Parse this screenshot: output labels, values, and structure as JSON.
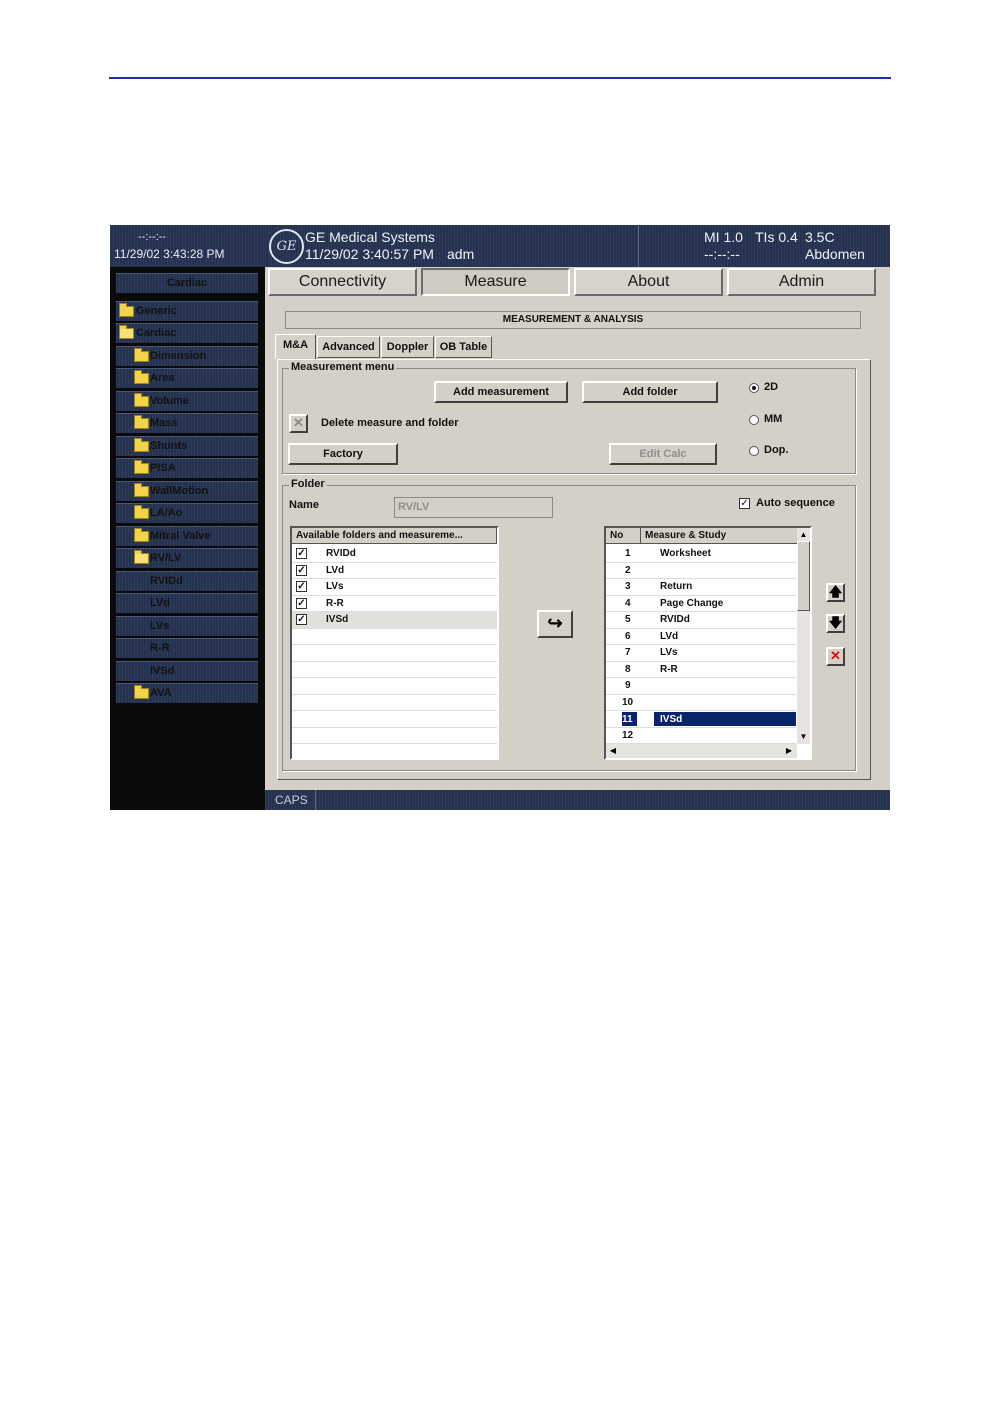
{
  "status_left": {
    "clock": "--:--:--",
    "datetime": "11/29/02 3:43:28 PM"
  },
  "header": {
    "logo": "GE",
    "system": "GE Medical Systems",
    "datetime": "11/29/02 3:40:57 PM",
    "user": "adm",
    "mi": "MI 1.0",
    "tis": "TIs 0.4",
    "probe": "3.5C",
    "dashes": "--:--:--",
    "application": "Abdomen"
  },
  "sidebar": {
    "title": "Cardiac",
    "items": [
      {
        "label": "Generic"
      },
      {
        "label": "Cardiac"
      },
      {
        "label": "Dimension"
      },
      {
        "label": "Area"
      },
      {
        "label": "Volume"
      },
      {
        "label": "Mass"
      },
      {
        "label": "Shunts"
      },
      {
        "label": "PISA"
      },
      {
        "label": "WallMotion"
      },
      {
        "label": "LA/Ao"
      },
      {
        "label": "Mitral Valve"
      },
      {
        "label": "RV/LV"
      },
      {
        "label": "RVIDd"
      },
      {
        "label": "LVd"
      },
      {
        "label": "LVs"
      },
      {
        "label": "R-R"
      },
      {
        "label": "IVSd"
      },
      {
        "label": "AVA"
      }
    ]
  },
  "tabs": [
    "Connectivity",
    "Measure",
    "About",
    "Admin"
  ],
  "page_title": "MEASUREMENT & ANALYSIS",
  "subtabs": [
    "M&A",
    "Advanced",
    "Doppler",
    "OB Table"
  ],
  "measurement_menu": {
    "legend": "Measurement menu",
    "add_measurement": "Add measurement",
    "add_folder": "Add folder",
    "delete_label": "Delete measure and folder",
    "factory": "Factory",
    "edit_calc": "Edit Calc",
    "modes": [
      "2D",
      "MM",
      "Dop."
    ],
    "selected_mode": "2D"
  },
  "folder": {
    "legend": "Folder",
    "name_label": "Name",
    "name_value": "RV/LV",
    "auto_sequence": "Auto sequence",
    "auto_checked": "✓"
  },
  "available_list": {
    "header": "Available folders and measureme...",
    "items": [
      {
        "label": "RVIDd",
        "check": "✓"
      },
      {
        "label": "LVd",
        "check": "✓"
      },
      {
        "label": "LVs",
        "check": "✓"
      },
      {
        "label": "R-R",
        "check": "✓"
      },
      {
        "label": "IVSd",
        "check": "✓"
      }
    ]
  },
  "transfer_glyph": "↪",
  "study_list": {
    "col_no": "No",
    "col_name": "Measure & Study",
    "rows": [
      {
        "no": "1",
        "name": "Worksheet"
      },
      {
        "no": "2",
        "name": ""
      },
      {
        "no": "3",
        "name": "Return"
      },
      {
        "no": "4",
        "name": "Page Change"
      },
      {
        "no": "5",
        "name": "RVIDd"
      },
      {
        "no": "6",
        "name": "LVd"
      },
      {
        "no": "7",
        "name": "LVs"
      },
      {
        "no": "8",
        "name": "R-R"
      },
      {
        "no": "9",
        "name": ""
      },
      {
        "no": "10",
        "name": ""
      },
      {
        "no": "11",
        "name": "IVSd"
      },
      {
        "no": "12",
        "name": ""
      }
    ],
    "selected_row": "11"
  },
  "side_buttons": {
    "up": "🡅",
    "down": "🡇",
    "delete": "✕"
  },
  "statusbar": {
    "caps": "CAPS"
  },
  "colors": {
    "screen_bg": "#0a0a0a",
    "header_blue": "#243250",
    "panel_gray": "#d4d0c8",
    "selection": "#0a246a",
    "delete_red": "#d01010"
  }
}
